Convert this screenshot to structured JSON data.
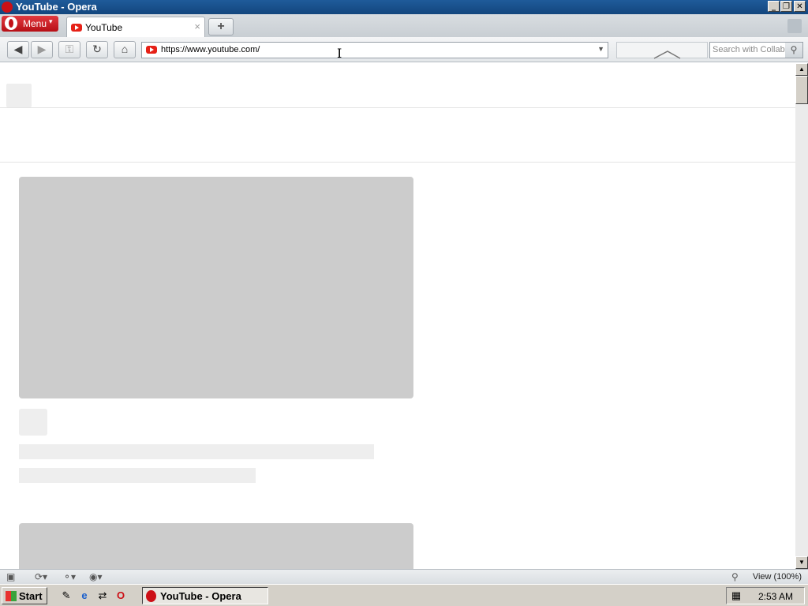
{
  "window": {
    "title": "YouTube - Opera",
    "controls": [
      "minimize",
      "restore",
      "close"
    ]
  },
  "tabbar": {
    "menu_label": "Menu",
    "tabs": [
      {
        "label": "YouTube",
        "close": "×"
      }
    ],
    "new_tab": "+"
  },
  "navbar": {
    "url": "https://www.youtube.com/",
    "search_placeholder": "Search with Collab'",
    "icons": [
      "back-icon",
      "forward-icon",
      "key-icon",
      "reload-icon",
      "home-icon"
    ]
  },
  "statusbar": {
    "zoom": "View (100%)"
  },
  "taskbar": {
    "start_label": "Start",
    "task_label": "YouTube - Opera",
    "clock": "2:53 AM"
  },
  "colors": {
    "titlebar": "#1b538f",
    "youtube_red": "#e62117",
    "opera_red": "#cc0f16",
    "skeleton_light": "#eeeeee",
    "skeleton_dark": "#cccccc"
  }
}
